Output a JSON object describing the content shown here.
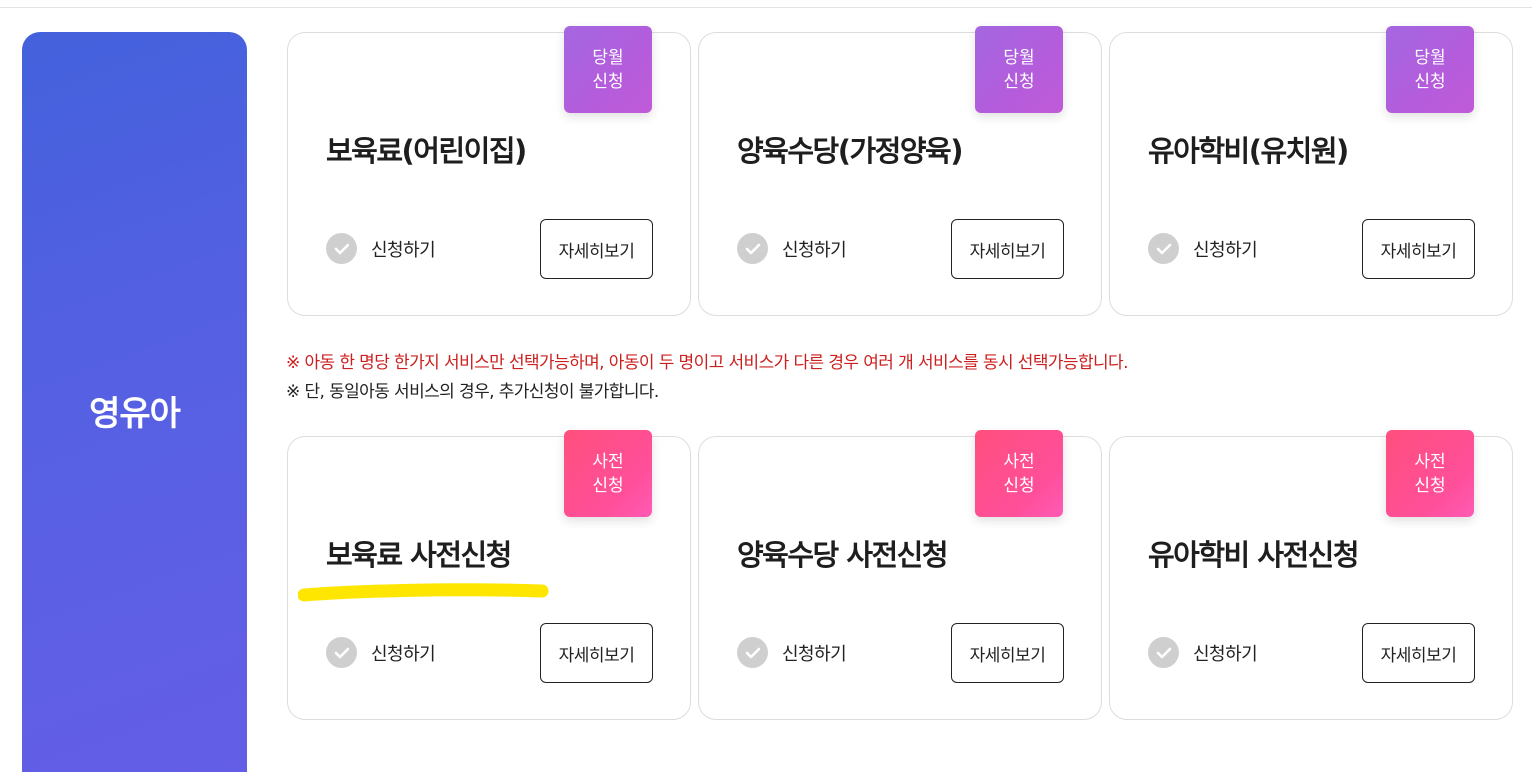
{
  "side_panel": {
    "label": "영유아"
  },
  "rows": [
    {
      "cards": [
        {
          "badge_line1": "당월",
          "badge_line2": "신청",
          "badge_color": "#b45cdc",
          "title": "보육료(어린이집)",
          "apply_label": "신청하기",
          "detail_label": "자세히보기"
        },
        {
          "badge_line1": "당월",
          "badge_line2": "신청",
          "badge_color": "#b45cdc",
          "title": "양육수당(가정양육)",
          "apply_label": "신청하기",
          "detail_label": "자세히보기"
        },
        {
          "badge_line1": "당월",
          "badge_line2": "신청",
          "badge_color": "#b45cdc",
          "title": "유아학비(유치원)",
          "apply_label": "신청하기",
          "detail_label": "자세히보기"
        }
      ]
    },
    {
      "cards": [
        {
          "badge_line1": "사전",
          "badge_line2": "신청",
          "badge_color": "#ff4f8f",
          "title": "보육료 사전신청",
          "apply_label": "신청하기",
          "detail_label": "자세히보기"
        },
        {
          "badge_line1": "사전",
          "badge_line2": "신청",
          "badge_color": "#ff4f8f",
          "title": "양육수당 사전신청",
          "apply_label": "신청하기",
          "detail_label": "자세히보기"
        },
        {
          "badge_line1": "사전",
          "badge_line2": "신청",
          "badge_color": "#ff4f8f",
          "title": "유아학비 사전신청",
          "apply_label": "신청하기",
          "detail_label": "자세히보기"
        }
      ]
    }
  ],
  "notices": {
    "line1": "※ 아동 한 명당 한가지 서비스만 선택가능하며, 아동이 두 명이고 서비스가 다른 경우 여러 개 서비스를 동시 선택가능합니다.",
    "line2": "※ 단, 동일아동 서비스의 경우, 추가신청이 불가합니다.",
    "line1_color": "#cc1f1f"
  },
  "highlight": {
    "color": "#ffe600"
  }
}
